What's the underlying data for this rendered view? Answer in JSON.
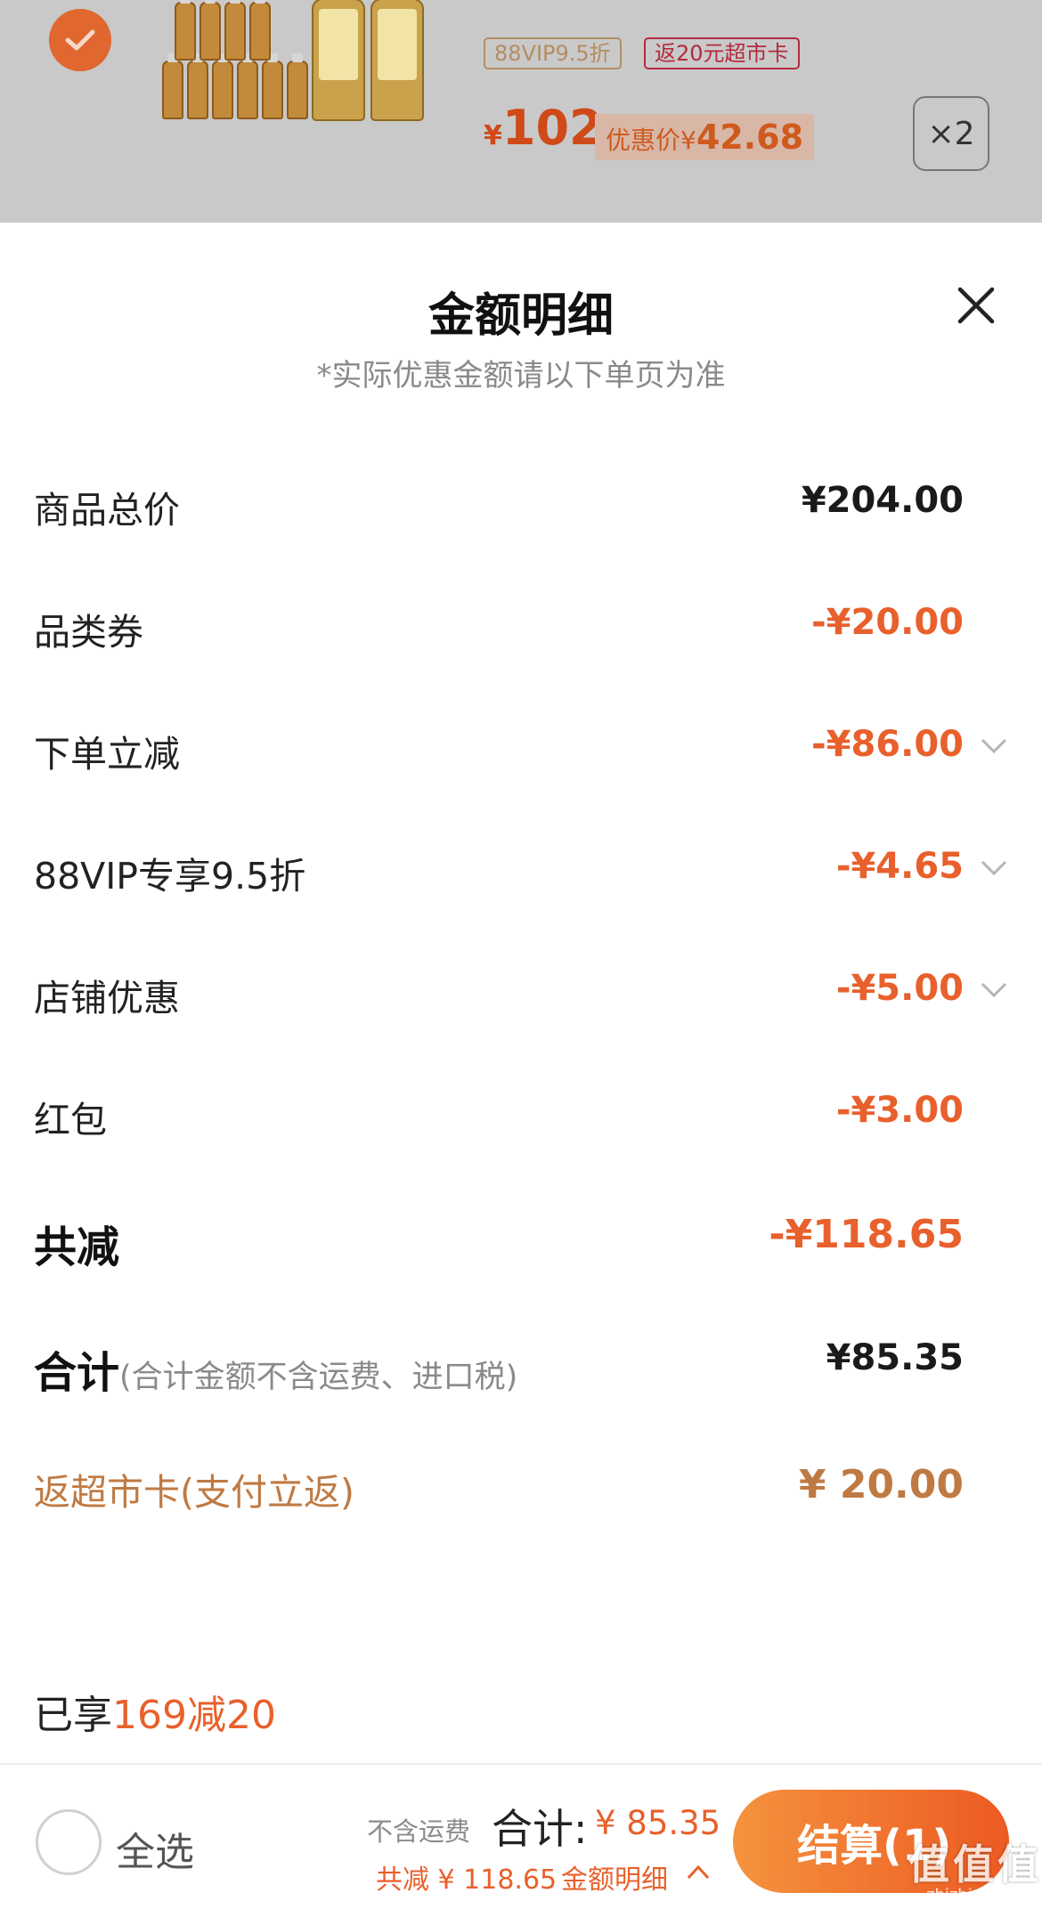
{
  "product": {
    "vip_badge": "88VIP9.5折",
    "return_badge": "返20元超市卡",
    "price_symbol": "¥",
    "price": "102",
    "promo_label": "优惠价¥",
    "promo_value": "42.68",
    "quantity": "×2"
  },
  "sheet": {
    "title": "金额明细",
    "subtitle": "*实际优惠金额请以下单页为准"
  },
  "rows": [
    {
      "label": "商品总价",
      "value": "¥204.00"
    },
    {
      "label": "品类券",
      "value": "-¥20.00"
    },
    {
      "label": "下单立减",
      "value": "-¥86.00"
    },
    {
      "label": "88VIP专享9.5折",
      "value": "-¥4.65"
    },
    {
      "label": "店铺优惠",
      "value": "-¥5.00"
    },
    {
      "label": "红包",
      "value": "-¥3.00"
    }
  ],
  "summary": {
    "total_reduce_label": "共减",
    "total_reduce_value": "-¥118.65",
    "sum_label": "合计",
    "sum_note": "(合计金额不含运费、进口税)",
    "sum_value": "¥85.35",
    "card_label": "返超市卡(支付立返)",
    "card_value": "¥ 20.00"
  },
  "enjoyed": {
    "prefix": "已享",
    "highlight": "169减20"
  },
  "bottom_bar": {
    "select_all": "全选",
    "no_shipping": "不含运费",
    "total_label": "合计:",
    "total_value": "¥ 85.35",
    "saved": "共减 ¥ 118.65",
    "detail_link": "金额明细",
    "checkout": "结算(1)"
  },
  "watermark": {
    "text": "值值值",
    "sub": "zhizhizhi.com"
  },
  "colors": {
    "accent": "#e8602c",
    "gold": "#bf7a43",
    "checkout_start": "#f5933d",
    "checkout_end": "#ec5a23"
  }
}
